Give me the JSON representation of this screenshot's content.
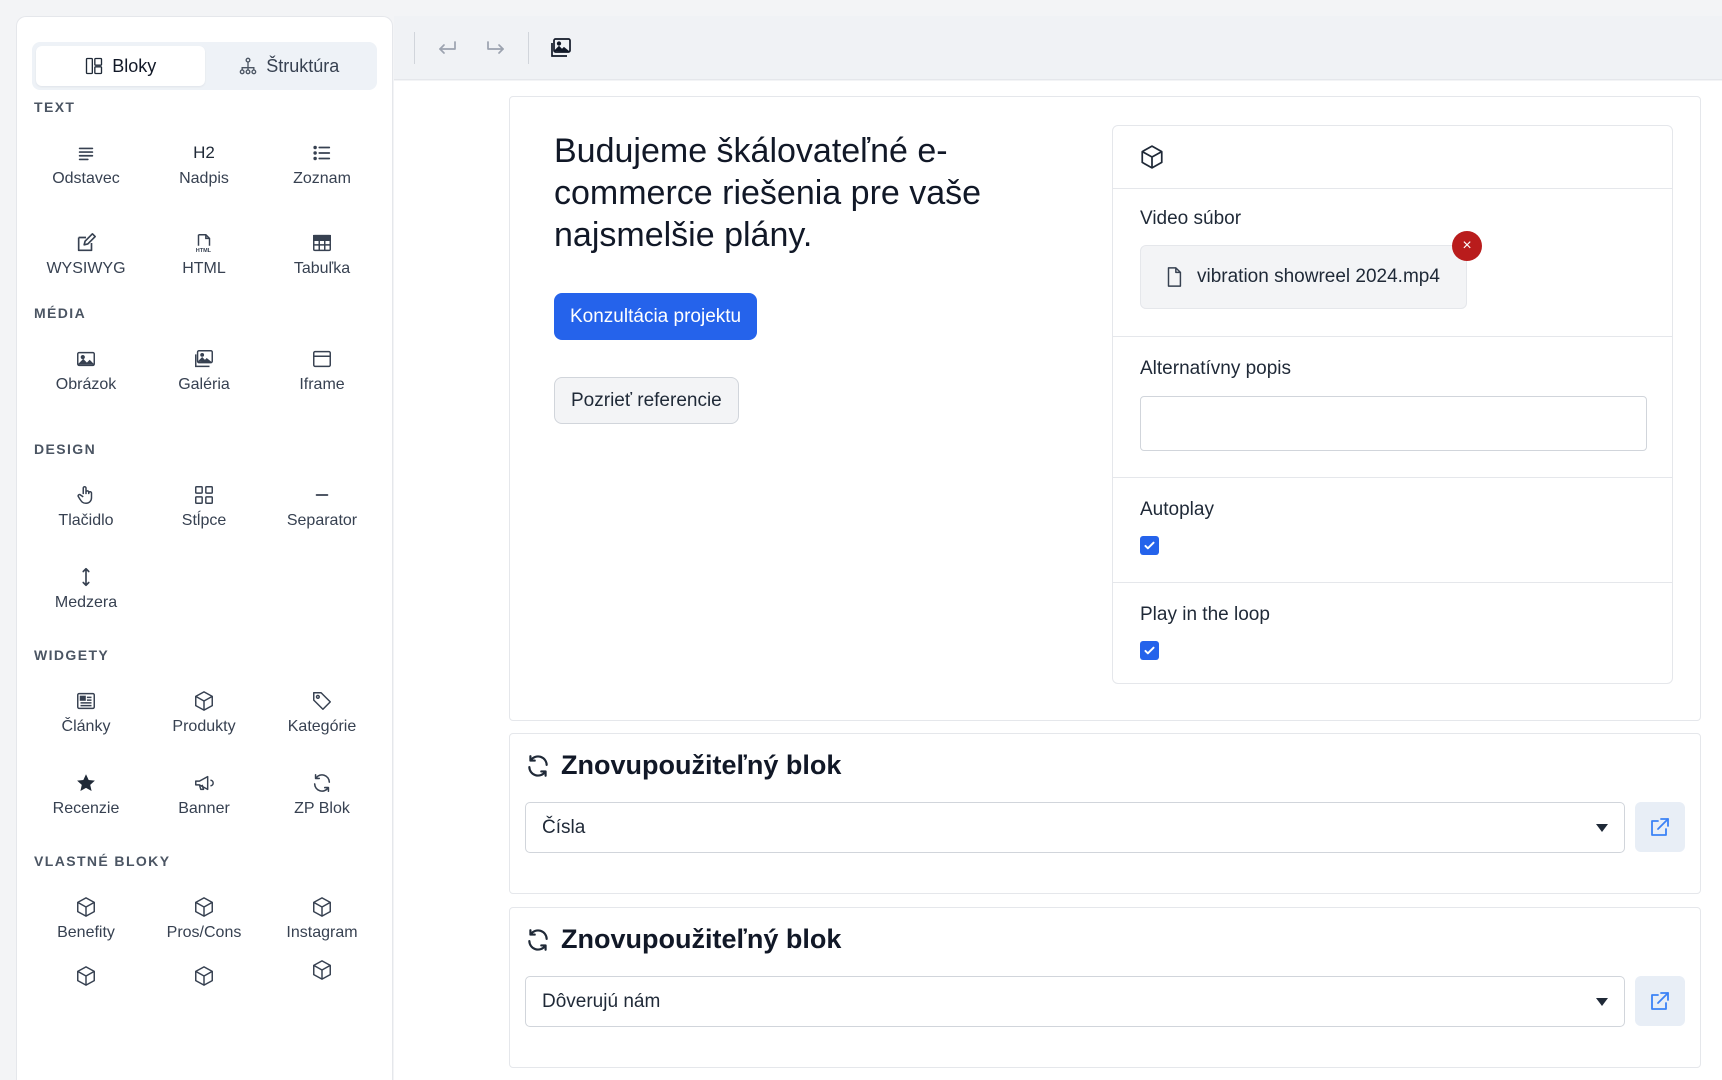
{
  "sidebar": {
    "tabs": [
      {
        "label": "Bloky",
        "icon": "layout-icon",
        "active": true
      },
      {
        "label": "Štruktúra",
        "icon": "hierarchy-icon",
        "active": false
      }
    ],
    "sections": {
      "text": "TEXT",
      "media": "MÉDIA",
      "design": "DESIGN",
      "widgets": "WIDGETY",
      "custom": "VLASTNÉ BLOKY"
    },
    "text_blocks": [
      {
        "label": "Odstavec",
        "icon": "paragraph-icon"
      },
      {
        "label": "Nadpis",
        "icon": "heading-icon",
        "glyph": "H2"
      },
      {
        "label": "Zoznam",
        "icon": "list-icon"
      },
      {
        "label": "WYSIWYG",
        "icon": "edit-icon"
      },
      {
        "label": "HTML",
        "icon": "html-file-icon"
      },
      {
        "label": "Tabuľka",
        "icon": "table-icon"
      }
    ],
    "media_blocks": [
      {
        "label": "Obrázok",
        "icon": "image-icon"
      },
      {
        "label": "Galéria",
        "icon": "gallery-icon"
      },
      {
        "label": "Iframe",
        "icon": "iframe-icon"
      }
    ],
    "design_blocks": [
      {
        "label": "Tlačidlo",
        "icon": "pointer-hand-icon"
      },
      {
        "label": "Stĺpce",
        "icon": "columns-icon"
      },
      {
        "label": "Separator",
        "icon": "separator-icon"
      },
      {
        "label": "Medzera",
        "icon": "vertical-arrows-icon"
      }
    ],
    "widget_blocks": [
      {
        "label": "Články",
        "icon": "newspaper-icon"
      },
      {
        "label": "Produkty",
        "icon": "cube-icon"
      },
      {
        "label": "Kategórie",
        "icon": "tag-icon"
      },
      {
        "label": "Recenzie",
        "icon": "star-icon"
      },
      {
        "label": "Banner",
        "icon": "megaphone-icon"
      },
      {
        "label": "ZP Blok",
        "icon": "sync-icon"
      }
    ],
    "custom_blocks": [
      {
        "label": "Benefity",
        "icon": "cube-icon"
      },
      {
        "label": "Pros/Cons",
        "icon": "cube-icon"
      },
      {
        "label": "Instagram",
        "icon": "cube-icon"
      }
    ]
  },
  "toolbar": {
    "buttons": [
      {
        "name": "undo",
        "icon": "undo-icon"
      },
      {
        "name": "redo",
        "icon": "redo-icon"
      },
      {
        "name": "media",
        "icon": "gallery-icon"
      }
    ]
  },
  "hero": {
    "title": "Budujeme škálovateľné e-commerce riešenia pre vaše najsmelšie plány.",
    "primary_button": "Konzultácia projektu",
    "secondary_button": "Pozrieť referencie"
  },
  "video_panel": {
    "header_icon": "cube-icon",
    "file_label": "Video súbor",
    "file_name": "vibration showreel 2024.mp4",
    "remove_glyph": "×",
    "alt_label": "Alternatívny popis",
    "alt_value": "",
    "autoplay_label": "Autoplay",
    "autoplay_checked": true,
    "loop_label": "Play in the loop",
    "loop_checked": true
  },
  "reusable_blocks": [
    {
      "title": "Znovupoužiteľný blok",
      "selected": "Čísla"
    },
    {
      "title": "Znovupoužiteľný blok",
      "selected": "Dôverujú nám"
    }
  ],
  "colors": {
    "accent": "#2563eb",
    "danger": "#b91c1c",
    "text": "#111827",
    "muted": "#4b5563"
  }
}
